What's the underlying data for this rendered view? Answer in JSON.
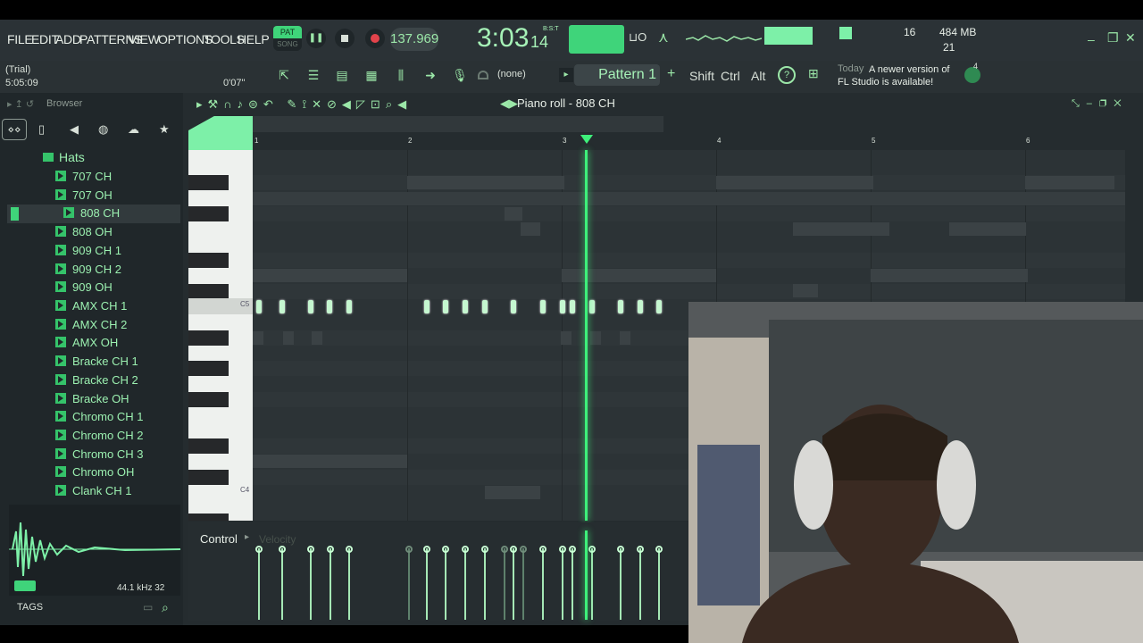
{
  "menu": [
    "FILE",
    "EDIT",
    "ADD",
    "PATTERNS",
    "VIEW",
    "OPTIONS",
    "TOOLS",
    "HELP"
  ],
  "transport": {
    "pat_label": "PAT",
    "song_label": "SONG",
    "tempo": "137.969",
    "time_main": "3:03",
    "time_small": "14",
    "bst": "B:S:T"
  },
  "meters": {
    "cpu": "16",
    "ram": "484 MB",
    "voices": "21"
  },
  "hint": {
    "trial": "(Trial)",
    "time": "5:05:09",
    "pos": "0'07\""
  },
  "pattern": {
    "none_label": "(none)",
    "name": "Pattern 1",
    "shift": "Shift",
    "ctrl": "Ctrl",
    "alt": "Alt"
  },
  "news": {
    "today": "Today",
    "message": "A newer version of FL Studio is available!",
    "badge": "4"
  },
  "browser": {
    "title": "Browser",
    "folder": "Hats",
    "tags": "TAGS",
    "samplerate": "44.1 kHz 32",
    "items": [
      "707 CH",
      "707 OH",
      "808 CH",
      "808 OH",
      "909 CH 1",
      "909 CH 2",
      "909 OH",
      "AMX CH 1",
      "AMX CH 2",
      "AMX OH",
      "Bracke CH 1",
      "Bracke CH 2",
      "Bracke OH",
      "Chromo CH 1",
      "Chromo CH 2",
      "Chromo CH 3",
      "Chromo OH",
      "Clank CH 1"
    ],
    "selected": "808 CH"
  },
  "pianoroll": {
    "title": "Piano roll - 808 CH",
    "bars": [
      "1",
      "2",
      "3",
      "4",
      "5",
      "6"
    ],
    "c5": "C5",
    "c4": "C4",
    "control": "Control",
    "velocity": "Velocity"
  },
  "colors": {
    "accent": "#35c36a",
    "note": "#c5f7d0",
    "playhead": "#3ef07a"
  }
}
